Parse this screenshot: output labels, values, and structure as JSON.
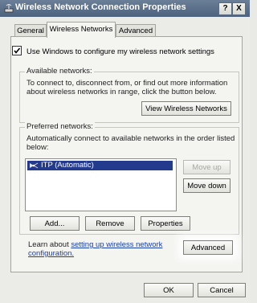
{
  "window": {
    "title": "Wireless Network Connection Properties",
    "help_label": "?",
    "close_label": "X"
  },
  "tabs": [
    {
      "label": "General"
    },
    {
      "label": "Wireless Networks"
    },
    {
      "label": "Advanced"
    }
  ],
  "wireless": {
    "use_windows_label": "Use Windows to configure my wireless network settings",
    "use_windows_checked": true
  },
  "available": {
    "legend": "Available networks:",
    "description_line1": "To connect to, disconnect from, or find out more information",
    "description_line2": "about wireless networks in range, click the button below.",
    "view_button": "View Wireless Networks"
  },
  "preferred": {
    "legend": "Preferred networks:",
    "description_line1": "Automatically connect to available networks in the order listed",
    "description_line2": "below:",
    "networks": [
      {
        "label": "ITP (Automatic)",
        "icon": "wireless-network-icon",
        "selected": true
      }
    ],
    "move_up": "Move up",
    "move_down": "Move down",
    "add": "Add...",
    "remove": "Remove",
    "properties": "Properties"
  },
  "learn": {
    "prefix": "Learn about ",
    "link_line1": "setting up wireless network",
    "link_line2": "configuration.",
    "suffix": ""
  },
  "advanced_button": "Advanced",
  "footer": {
    "ok": "OK",
    "cancel": "Cancel"
  },
  "colors": {
    "titlebar": "#4d627e",
    "selection": "#243a8c",
    "link": "#1a3fa8"
  }
}
